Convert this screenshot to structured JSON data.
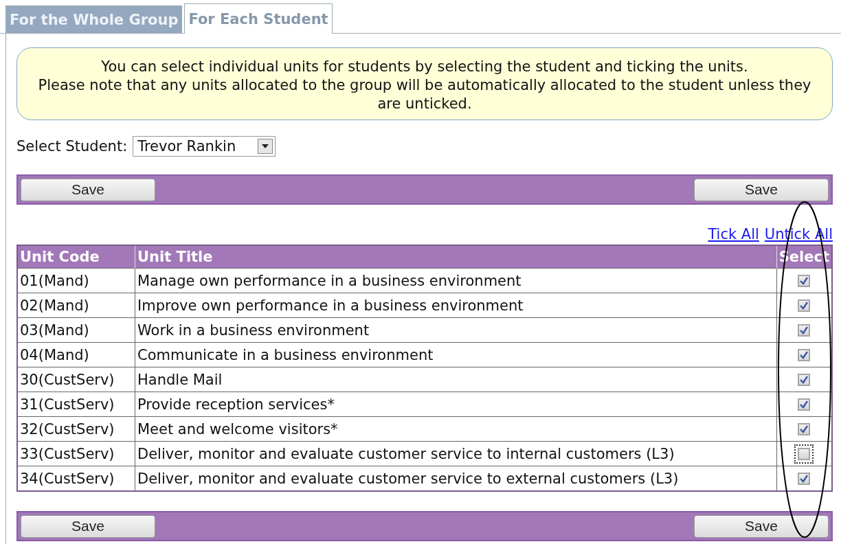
{
  "tabs": [
    {
      "label": "For the Whole Group",
      "selected": false
    },
    {
      "label": "For Each Student",
      "selected": true
    }
  ],
  "notice": {
    "lines": [
      "You can select individual units for students by selecting the student and ticking the units.",
      "Please note that any units allocated to the group will be automatically allocated to the student unless they are unticked."
    ]
  },
  "student_select": {
    "label": "Select Student:",
    "value": "Trevor Rankin"
  },
  "top_bar": {
    "buttons": [
      "Save",
      "Save"
    ]
  },
  "links": [
    "Tick All",
    "Untick All"
  ],
  "table": {
    "columns": [
      "Unit Code",
      "Unit Title",
      "Select"
    ],
    "rows": [
      {
        "code": "01(Mand)",
        "title": "Manage own performance in a business environment",
        "checked": true,
        "focused": false
      },
      {
        "code": "02(Mand)",
        "title": "Improve own performance in a business environment",
        "checked": true,
        "focused": false
      },
      {
        "code": "03(Mand)",
        "title": "Work in a business environment",
        "checked": true,
        "focused": false
      },
      {
        "code": "04(Mand)",
        "title": "Communicate in a business environment",
        "checked": true,
        "focused": false
      },
      {
        "code": "30(CustServ)",
        "title": "Handle Mail",
        "checked": true,
        "focused": false
      },
      {
        "code": "31(CustServ)",
        "title": "Provide reception services*",
        "checked": true,
        "focused": false
      },
      {
        "code": "32(CustServ)",
        "title": "Meet and welcome visitors*",
        "checked": true,
        "focused": false
      },
      {
        "code": "33(CustServ)",
        "title": "Deliver, monitor and evaluate customer service to internal customers (L3)",
        "checked": false,
        "focused": true
      },
      {
        "code": "34(CustServ)",
        "title": "Deliver, monitor and evaluate customer service to external customers (L3)",
        "checked": true,
        "focused": false
      }
    ]
  },
  "bottom_bar": {
    "buttons": [
      "Save",
      "Save"
    ]
  }
}
